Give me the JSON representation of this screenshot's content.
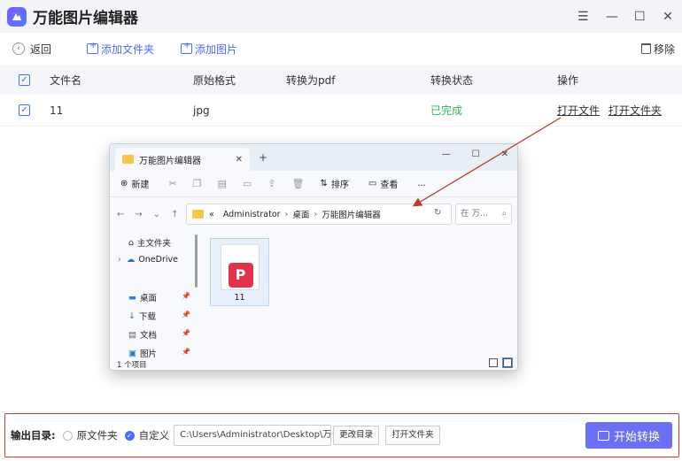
{
  "app": {
    "title": "万能图片编辑器"
  },
  "window_controls": [
    "☰",
    "—",
    "☐",
    "✕"
  ],
  "toolbar": {
    "back": "返回",
    "add_folder": "添加文件夹",
    "add_image": "添加图片",
    "remove": "移除"
  },
  "table": {
    "headers": [
      "文件名",
      "原始格式",
      "转换为pdf",
      "转换状态",
      "操作"
    ],
    "rows": [
      {
        "name": "11",
        "format": "jpg",
        "target": "",
        "status": "已完成",
        "open_file": "打开文件",
        "open_folder": "打开文件夹"
      }
    ]
  },
  "explorer": {
    "tab_title": "万能图片编辑器",
    "commands": {
      "new": "新建",
      "sort": "排序",
      "view": "查看",
      "more": "..."
    },
    "address": [
      "«",
      "Administrator",
      "桌面",
      "万能图片编辑器"
    ],
    "search_placeholder": "在 万...",
    "sidebar": [
      "主文件夹",
      "OneDrive",
      "桌面",
      "下载",
      "文档",
      "图片"
    ],
    "file": {
      "name": "11",
      "icon": "pdf-file-icon"
    },
    "status": "1 个项目"
  },
  "bottom": {
    "output_label": "输出目录:",
    "option_original": "原文件夹",
    "option_custom": "自定义",
    "path": "C:\\Users\\Administrator\\Desktop\\万...",
    "change_dir": "更改目录",
    "open_folder": "打开文件夹",
    "start": "开始转换"
  },
  "colors": {
    "accent": "#4a6cf7",
    "success": "#2fb35e",
    "highlight_border": "#d93636",
    "start_button": "#6b6ff5"
  }
}
